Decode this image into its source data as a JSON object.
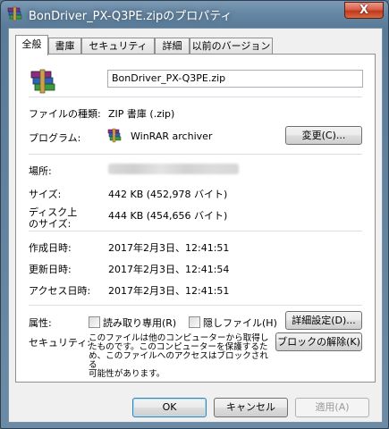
{
  "window": {
    "title": "BonDriver_PX-Q3PE.zipのプロパティ",
    "close_glyph": "X"
  },
  "tabs": [
    {
      "label": "全般",
      "active": true
    },
    {
      "label": "書庫",
      "active": false
    },
    {
      "label": "セキュリティ",
      "active": false
    },
    {
      "label": "詳細",
      "active": false
    },
    {
      "label": "以前のバージョン",
      "active": false
    }
  ],
  "general": {
    "file_name": "BonDriver_PX-Q3PE.zip",
    "type_label": "ファイルの種類:",
    "type_value": "ZIP 書庫 (.zip)",
    "program_label": "プログラム:",
    "program_value": "WinRAR archiver",
    "change_button": "変更(C)...",
    "location_label": "場所:",
    "size_label": "サイズ:",
    "size_value": "442 KB (452,978 バイト)",
    "disk_size_label_1": "ディスク上",
    "disk_size_label_2": "のサイズ:",
    "disk_size_value": "444 KB (454,656 バイト)",
    "created_label": "作成日時:",
    "created_value": "2017年2月3日、12:41:51",
    "modified_label": "更新日時:",
    "modified_value": "2017年2月3日、12:41:54",
    "accessed_label": "アクセス日時:",
    "accessed_value": "2017年2月3日、12:41:51",
    "attributes_label": "属性:",
    "readonly_label": "読み取り専用(R)",
    "hidden_label": "隠しファイル(H)",
    "advanced_button": "詳細設定(D)...",
    "security_label": "セキュリティ:",
    "security_text": [
      "このファイルは他のコンピューターから取得し",
      "たものです。このコンピューターを保護するた",
      "め、このファイルへのアクセスはブロックされる",
      "可能性があります。"
    ],
    "unblock_button": "ブロックの解除(K)"
  },
  "footer": {
    "ok": "OK",
    "cancel": "キャンセル",
    "apply": "適用(A)"
  },
  "colors": {
    "titlebar": "#6587a4",
    "close_button": "#c2381f",
    "dialog_bg": "#f0f0f0",
    "panel_bg": "#ffffff",
    "separator": "#d5dfe5"
  }
}
